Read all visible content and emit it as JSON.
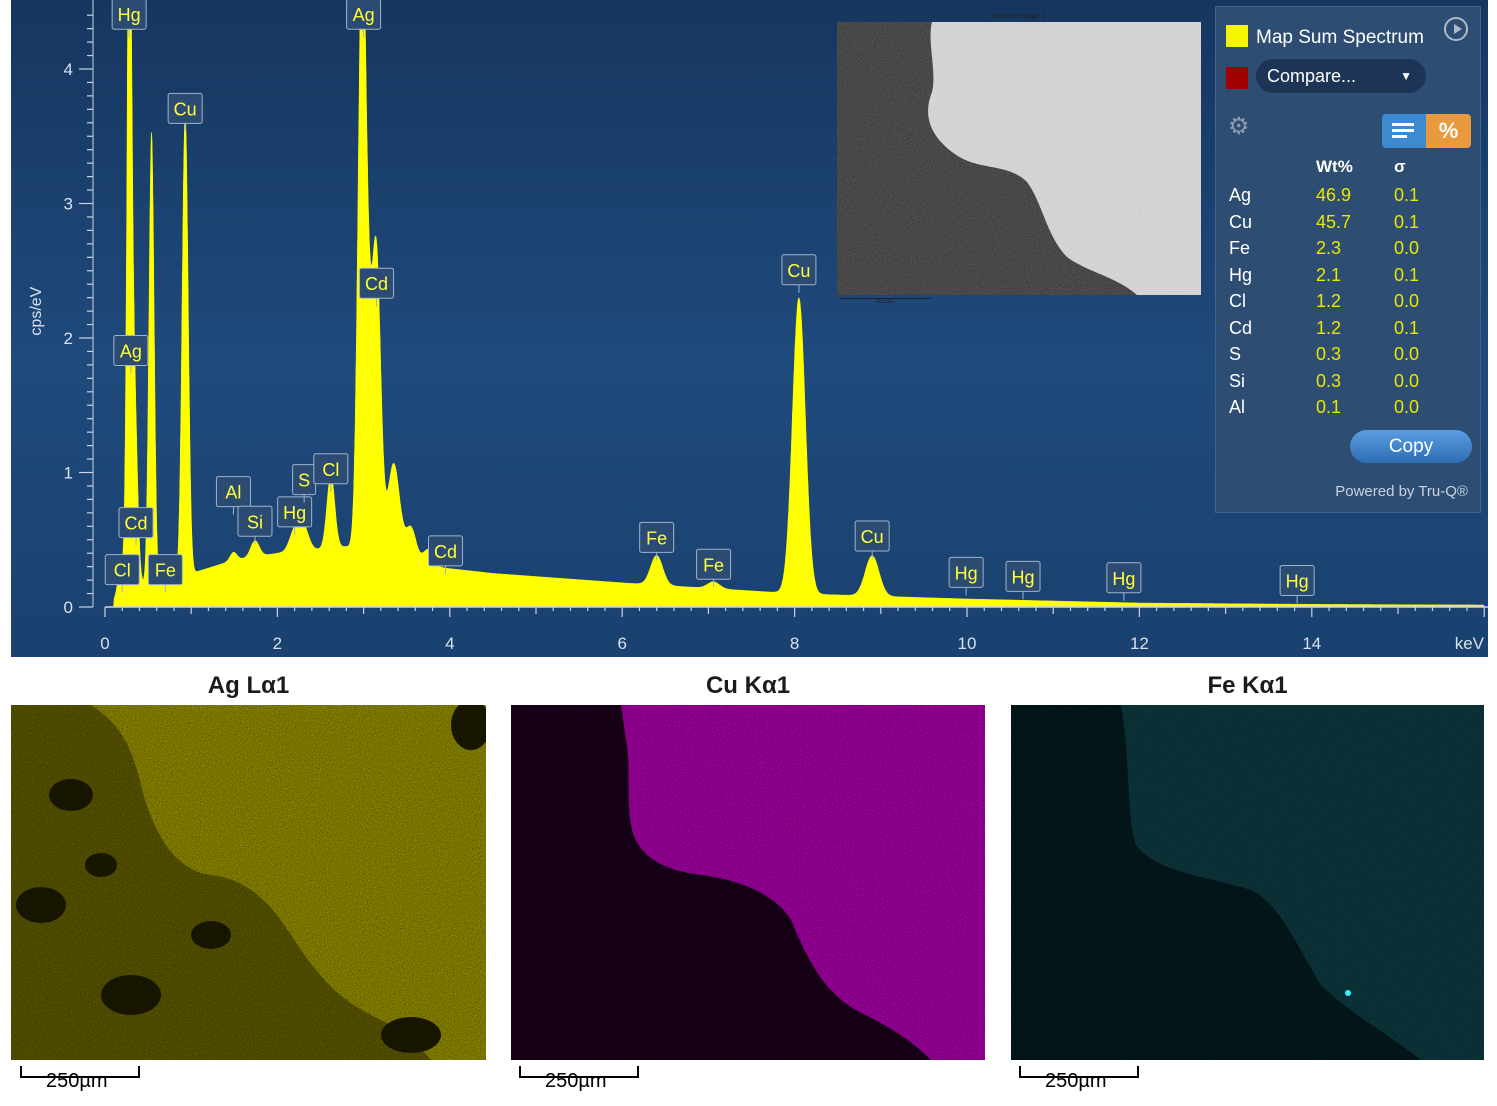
{
  "spectrum": {
    "y_axis_label": "cps/eV",
    "x_axis_unit": "keV",
    "y_ticks": [
      "0",
      "1",
      "2",
      "3",
      "4"
    ],
    "x_ticks": [
      "0",
      "2",
      "4",
      "6",
      "8",
      "10",
      "12",
      "14"
    ],
    "peak_labels": [
      {
        "text": "Hg",
        "kev": 0.28,
        "cps": 4.4
      },
      {
        "text": "Ag",
        "kev": 3.0,
        "cps": 4.4
      },
      {
        "text": "Cu",
        "kev": 0.93,
        "cps": 3.7
      },
      {
        "text": "Ag",
        "kev": 0.3,
        "cps": 1.9
      },
      {
        "text": "Cd",
        "kev": 3.15,
        "cps": 2.4
      },
      {
        "text": "Cu",
        "kev": 8.05,
        "cps": 2.5
      },
      {
        "text": "Cd",
        "kev": 0.36,
        "cps": 0.62
      },
      {
        "text": "Cl",
        "kev": 0.2,
        "cps": 0.27
      },
      {
        "text": "Fe",
        "kev": 0.7,
        "cps": 0.27
      },
      {
        "text": "Al",
        "kev": 1.49,
        "cps": 0.85
      },
      {
        "text": "Si",
        "kev": 1.74,
        "cps": 0.63
      },
      {
        "text": "Hg",
        "kev": 2.2,
        "cps": 0.7
      },
      {
        "text": "S",
        "kev": 2.31,
        "cps": 0.94
      },
      {
        "text": "Cl",
        "kev": 2.62,
        "cps": 1.02
      },
      {
        "text": "Cd",
        "kev": 3.95,
        "cps": 0.41
      },
      {
        "text": "Fe",
        "kev": 6.4,
        "cps": 0.51
      },
      {
        "text": "Fe",
        "kev": 7.06,
        "cps": 0.31
      },
      {
        "text": "Cu",
        "kev": 8.9,
        "cps": 0.52
      },
      {
        "text": "Hg",
        "kev": 9.99,
        "cps": 0.25
      },
      {
        "text": "Hg",
        "kev": 10.65,
        "cps": 0.22
      },
      {
        "text": "Hg",
        "kev": 11.82,
        "cps": 0.21
      },
      {
        "text": "Hg",
        "kev": 13.83,
        "cps": 0.19
      }
    ]
  },
  "chart_data": {
    "type": "area",
    "title": "",
    "xlabel": "keV",
    "ylabel": "cps/eV",
    "xlim": [
      0,
      16
    ],
    "ylim": [
      0,
      4.4
    ],
    "peaks": [
      {
        "kev": 0.18,
        "cps": 0.18,
        "width": 0.03
      },
      {
        "kev": 0.28,
        "cps": 4.25,
        "width": 0.025
      },
      {
        "kev": 0.31,
        "cps": 1.8,
        "width": 0.04
      },
      {
        "kev": 0.36,
        "cps": 0.45,
        "width": 0.03
      },
      {
        "kev": 0.54,
        "cps": 3.35,
        "width": 0.03
      },
      {
        "kev": 0.71,
        "cps": 0.12,
        "width": 0.03
      },
      {
        "kev": 0.93,
        "cps": 3.45,
        "width": 0.035
      },
      {
        "kev": 1.49,
        "cps": 0.06,
        "width": 0.04
      },
      {
        "kev": 1.74,
        "cps": 0.12,
        "width": 0.05
      },
      {
        "kev": 2.2,
        "cps": 0.15,
        "width": 0.06
      },
      {
        "kev": 2.3,
        "cps": 0.18,
        "width": 0.06
      },
      {
        "kev": 2.62,
        "cps": 0.55,
        "width": 0.045
      },
      {
        "kev": 2.98,
        "cps": 4.2,
        "width": 0.045
      },
      {
        "kev": 3.05,
        "cps": 1.2,
        "width": 0.05
      },
      {
        "kev": 3.15,
        "cps": 2.15,
        "width": 0.05
      },
      {
        "kev": 3.35,
        "cps": 0.7,
        "width": 0.07
      },
      {
        "kev": 3.55,
        "cps": 0.25,
        "width": 0.06
      },
      {
        "kev": 3.75,
        "cps": 0.12,
        "width": 0.06
      },
      {
        "kev": 6.4,
        "cps": 0.22,
        "width": 0.07
      },
      {
        "kev": 7.06,
        "cps": 0.05,
        "width": 0.07
      },
      {
        "kev": 8.05,
        "cps": 2.2,
        "width": 0.075
      },
      {
        "kev": 8.9,
        "cps": 0.3,
        "width": 0.08
      }
    ],
    "background": [
      [
        0.1,
        0.05
      ],
      [
        0.2,
        0.15
      ],
      [
        0.8,
        0.2
      ],
      [
        1.0,
        0.25
      ],
      [
        1.5,
        0.35
      ],
      [
        2.0,
        0.4
      ],
      [
        2.8,
        0.45
      ],
      [
        3.8,
        0.3
      ],
      [
        4.5,
        0.25
      ],
      [
        6,
        0.18
      ],
      [
        8,
        0.1
      ],
      [
        10,
        0.06
      ],
      [
        12,
        0.03
      ],
      [
        14,
        0.02
      ],
      [
        16,
        0.015
      ]
    ],
    "grid": false
  },
  "electron_image": {
    "title": "Electron Image 1",
    "scale": "250µm"
  },
  "quant": {
    "spectrum_name": "Map Sum Spectrum",
    "spectrum_color": "#f5f500",
    "compare_color": "#a00000",
    "compare_label": "Compare...",
    "chevron": "▼",
    "gear_icon": "⚙",
    "percent_icon": "%",
    "col_wt": "Wt%",
    "col_sigma": "σ",
    "rows": [
      {
        "el": "Ag",
        "wt": "46.9",
        "sigma": "0.1"
      },
      {
        "el": "Cu",
        "wt": "45.7",
        "sigma": "0.1"
      },
      {
        "el": "Fe",
        "wt": "2.3",
        "sigma": "0.0"
      },
      {
        "el": "Hg",
        "wt": "2.1",
        "sigma": "0.1"
      },
      {
        "el": "Cl",
        "wt": "1.2",
        "sigma": "0.0"
      },
      {
        "el": "Cd",
        "wt": "1.2",
        "sigma": "0.1"
      },
      {
        "el": "S",
        "wt": "0.3",
        "sigma": "0.0"
      },
      {
        "el": "Si",
        "wt": "0.3",
        "sigma": "0.0"
      },
      {
        "el": "Al",
        "wt": "0.1",
        "sigma": "0.0"
      }
    ],
    "copy_label": "Copy",
    "powered_by": "Powered by Tru-Q®"
  },
  "maps": [
    {
      "title": "Ag Lα1",
      "scale": "250µm",
      "color": "#c8c400"
    },
    {
      "title": "Cu Kα1",
      "scale": "250µm",
      "color": "#c800c8"
    },
    {
      "title": "Fe Kα1",
      "scale": "250µm",
      "color": "#19b8c0"
    }
  ]
}
